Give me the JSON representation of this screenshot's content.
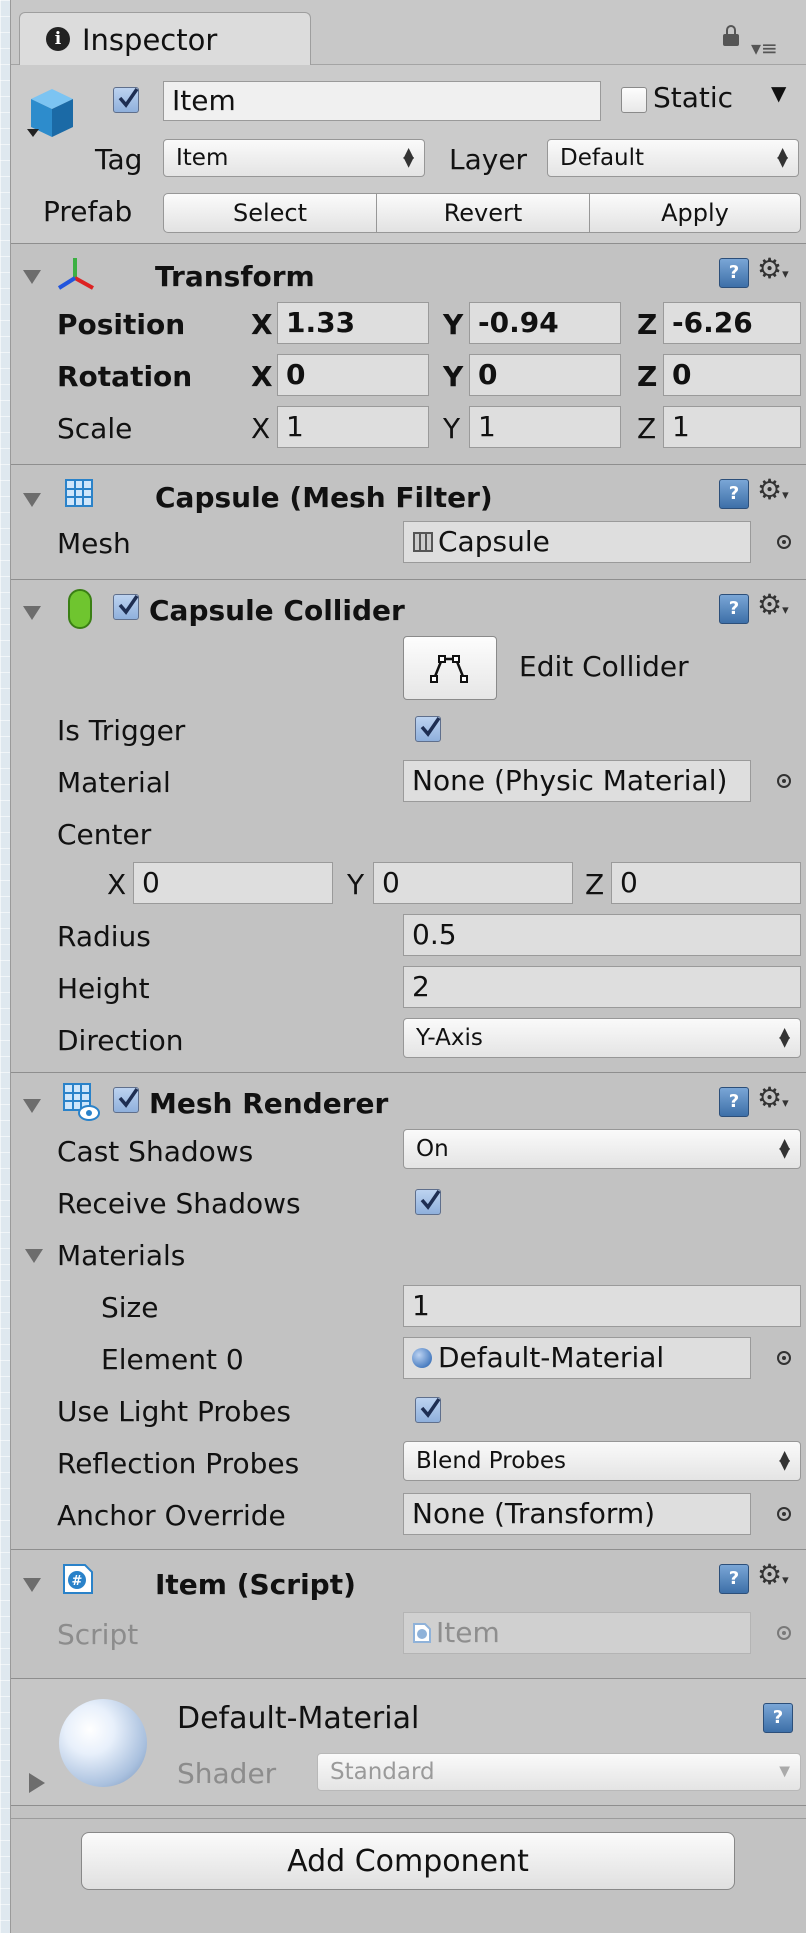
{
  "tab": {
    "title": "Inspector"
  },
  "header": {
    "name": "Item",
    "static_label": "Static",
    "tag_label": "Tag",
    "tag_value": "Item",
    "layer_label": "Layer",
    "layer_value": "Default",
    "prefab_label": "Prefab",
    "prefab_buttons": [
      "Select",
      "Revert",
      "Apply"
    ]
  },
  "transform": {
    "title": "Transform",
    "axis_labels": [
      "X",
      "Y",
      "Z"
    ],
    "position": {
      "label": "Position",
      "x": "1.33",
      "y": "-0.94",
      "z": "-6.26"
    },
    "rotation": {
      "label": "Rotation",
      "x": "0",
      "y": "0",
      "z": "0"
    },
    "scale": {
      "label": "Scale",
      "x": "1",
      "y": "1",
      "z": "1"
    }
  },
  "mesh_filter": {
    "title": "Capsule (Mesh Filter)",
    "mesh_label": "Mesh",
    "mesh_value": "Capsule"
  },
  "capsule_collider": {
    "title": "Capsule Collider",
    "edit_collider": "Edit Collider",
    "is_trigger_label": "Is Trigger",
    "is_trigger": true,
    "material_label": "Material",
    "material_value": "None (Physic Material)",
    "center_label": "Center",
    "center": {
      "x": "0",
      "y": "0",
      "z": "0"
    },
    "radius_label": "Radius",
    "radius": "0.5",
    "height_label": "Height",
    "height": "2",
    "direction_label": "Direction",
    "direction": "Y-Axis"
  },
  "mesh_renderer": {
    "title": "Mesh Renderer",
    "cast_shadows_label": "Cast Shadows",
    "cast_shadows": "On",
    "receive_shadows_label": "Receive Shadows",
    "receive_shadows": true,
    "materials_label": "Materials",
    "size_label": "Size",
    "size": "1",
    "element0_label": "Element 0",
    "element0": "Default-Material",
    "use_light_probes_label": "Use Light Probes",
    "use_light_probes": true,
    "reflection_probes_label": "Reflection Probes",
    "reflection_probes": "Blend Probes",
    "anchor_override_label": "Anchor Override",
    "anchor_override": "None (Transform)"
  },
  "item_script": {
    "title": "Item (Script)",
    "script_label": "Script",
    "script_value": "Item"
  },
  "material_preview": {
    "name": "Default-Material",
    "shader_label": "Shader",
    "shader_value": "Standard"
  },
  "add_component": "Add Component",
  "colors": {
    "panel": "#c2c2c2",
    "check_fill": "#a9c4ea",
    "help_icon": "#4f7fb8"
  }
}
